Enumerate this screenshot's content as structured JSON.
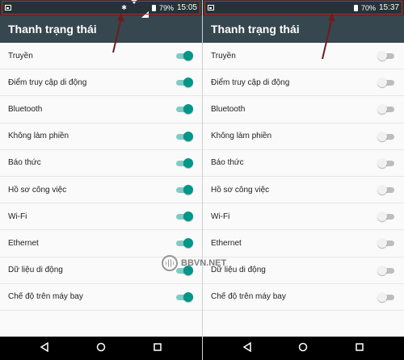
{
  "left": {
    "status": {
      "battery": "79%",
      "time": "15:05"
    },
    "title": "Thanh trạng thái",
    "items": [
      {
        "label": "Truyền",
        "on": true
      },
      {
        "label": "Điểm truy cập di động",
        "on": true
      },
      {
        "label": "Bluetooth",
        "on": true
      },
      {
        "label": "Không làm phiền",
        "on": true
      },
      {
        "label": "Báo thức",
        "on": true
      },
      {
        "label": "Hồ sơ công việc",
        "on": true
      },
      {
        "label": "Wi-Fi",
        "on": true
      },
      {
        "label": "Ethernet",
        "on": true
      },
      {
        "label": "Dữ liệu di động",
        "on": true
      },
      {
        "label": "Chế độ trên máy bay",
        "on": true
      }
    ]
  },
  "right": {
    "status": {
      "battery": "70%",
      "time": "15:37"
    },
    "title": "Thanh trạng thái",
    "items": [
      {
        "label": "Truyền",
        "on": false
      },
      {
        "label": "Điểm truy cập di động",
        "on": false
      },
      {
        "label": "Bluetooth",
        "on": false
      },
      {
        "label": "Không làm phiền",
        "on": false
      },
      {
        "label": "Báo thức",
        "on": false
      },
      {
        "label": "Hồ sơ công việc",
        "on": false
      },
      {
        "label": "Wi-Fi",
        "on": false
      },
      {
        "label": "Ethernet",
        "on": false
      },
      {
        "label": "Dữ liệu di động",
        "on": false
      },
      {
        "label": "Chế độ trên máy bay",
        "on": false
      }
    ]
  },
  "watermark": {
    "text": "BBVN.NET"
  },
  "colors": {
    "accent": "#009688",
    "statusbar": "#263238",
    "appbar": "#37474f",
    "highlight": "#c62828"
  },
  "icons": [
    "image-icon",
    "bluetooth-icon",
    "wifi-icon",
    "signal-icon",
    "battery-icon",
    "back-icon",
    "home-icon",
    "recents-icon"
  ]
}
